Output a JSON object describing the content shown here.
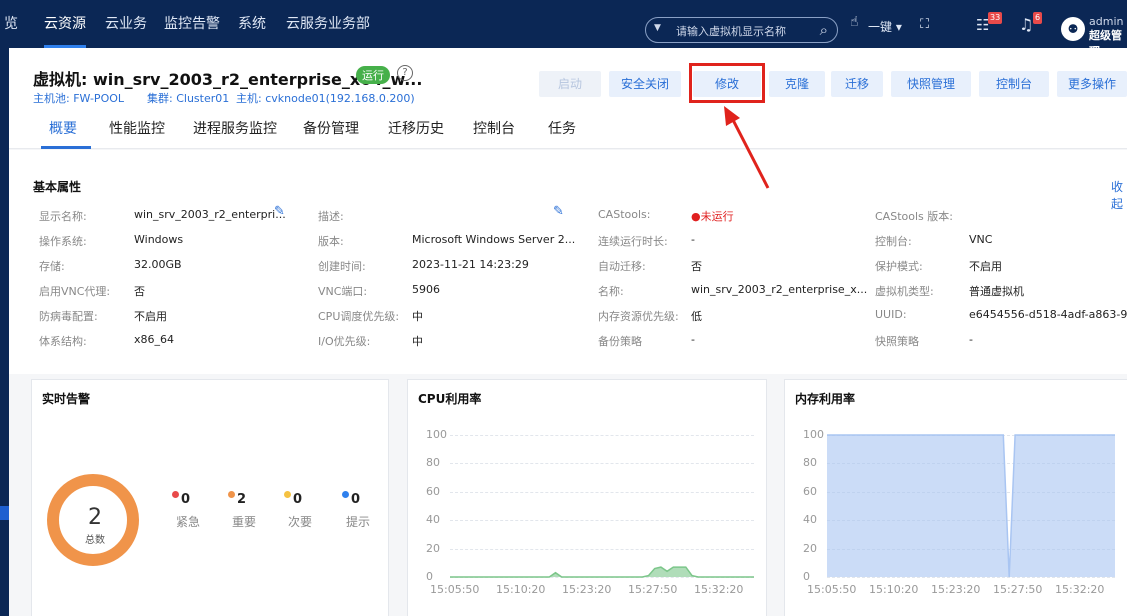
{
  "nav": {
    "items": [
      "览",
      "云资源",
      "云业务",
      "监控告警",
      "系统",
      "云服务业务部"
    ]
  },
  "search": {
    "placeholder": "请输入虚拟机显示名称"
  },
  "toolbar": {
    "key_label": "一键 ▾",
    "list_badge": "33",
    "bell_badge": "6"
  },
  "user": {
    "name": "admin",
    "role": "超级管理"
  },
  "vm": {
    "title": "虚拟机: win_srv_2003_r2_enterprise_x64_w...",
    "status": "运行",
    "pool": "主机池: FW-POOL",
    "cluster": "集群: Cluster01",
    "host": "主机: cvknode01(192.168.0.200)"
  },
  "actions": [
    "启动",
    "安全关闭",
    "修改",
    "克隆",
    "迁移",
    "快照管理",
    "控制台",
    "更多操作"
  ],
  "tabs": [
    "概要",
    "性能监控",
    "进程服务监控",
    "备份管理",
    "迁移历史",
    "控制台",
    "任务"
  ],
  "basic": {
    "title": "基本属性",
    "collapse": "收起",
    "props": [
      [
        "显示名称:",
        "win_srv_2003_r2_enterpri...",
        "描述:",
        "",
        "CAStools:",
        "●未运行",
        "CAStools 版本:",
        ""
      ],
      [
        "操作系统:",
        "Windows",
        "版本:",
        "Microsoft Windows Server 2...",
        "连续运行时长:",
        "-",
        "控制台:",
        "VNC"
      ],
      [
        "存储:",
        "32.00GB",
        "创建时间:",
        "2023-11-21 14:23:29",
        "自动迁移:",
        "否",
        "保护模式:",
        "不启用"
      ],
      [
        "启用VNC代理:",
        "否",
        "VNC端口:",
        "5906",
        "名称:",
        "win_srv_2003_r2_enterprise_x...",
        "虚拟机类型:",
        "普通虚拟机"
      ],
      [
        "防病毒配置:",
        "不启用",
        "CPU调度优先级:",
        "中",
        "内存资源优先级:",
        "低",
        "UUID:",
        "e6454556-d518-4adf-a863-9..."
      ],
      [
        "体系结构:",
        "x86_64",
        "I/O优先级:",
        "中",
        "备份策略",
        "-",
        "快照策略",
        "-"
      ]
    ]
  },
  "alarm": {
    "title": "实时告警",
    "total": "2",
    "total_label": "总数",
    "legend": [
      {
        "count": "0",
        "label": "紧急",
        "color": "#e84a4a"
      },
      {
        "count": "2",
        "label": "重要",
        "color": "#f0944a"
      },
      {
        "count": "0",
        "label": "次要",
        "color": "#f5c242"
      },
      {
        "count": "0",
        "label": "提示",
        "color": "#2f80ed"
      }
    ]
  },
  "cpu": {
    "title": "CPU利用率"
  },
  "mem": {
    "title": "内存利用率"
  },
  "chart_data": [
    {
      "type": "area",
      "title": "CPU利用率",
      "x": [
        "15:05:50",
        "15:10:20",
        "15:23:20",
        "15:27:50",
        "15:32:20"
      ],
      "yticks": [
        "100",
        "80",
        "60",
        "40",
        "20",
        "0"
      ],
      "ylim": [
        0,
        100
      ],
      "grid": true,
      "series": [
        {
          "values": [
            0,
            0,
            0,
            0,
            0,
            0,
            0,
            0,
            0,
            0,
            0,
            0,
            0,
            0,
            0,
            0,
            0,
            3,
            0,
            0,
            0,
            0,
            0,
            0,
            0,
            0,
            0,
            0,
            0,
            0,
            0,
            0,
            1,
            6,
            7,
            4,
            7,
            7,
            7,
            1,
            0,
            0,
            0,
            0,
            0,
            0,
            0,
            0,
            0,
            0
          ]
        }
      ],
      "color": "#7cc68a"
    },
    {
      "type": "area",
      "title": "内存利用率",
      "x": [
        "15:05:50",
        "15:10:20",
        "15:23:20",
        "15:27:50",
        "15:32:20"
      ],
      "yticks": [
        "100",
        "80",
        "60",
        "40",
        "20",
        "0"
      ],
      "ylim": [
        0,
        100
      ],
      "grid": true,
      "series": [
        {
          "values": [
            100,
            100,
            100,
            100,
            100,
            100,
            100,
            100,
            100,
            100,
            100,
            100,
            100,
            100,
            100,
            100,
            100,
            100,
            100,
            100,
            100,
            100,
            100,
            100,
            100,
            100,
            100,
            100,
            100,
            100,
            100,
            0,
            100,
            100,
            100,
            100,
            100,
            100,
            100,
            100,
            100,
            100,
            100,
            100,
            100,
            100,
            100,
            100,
            100,
            100
          ]
        }
      ],
      "color": "#a9c5f2"
    }
  ]
}
